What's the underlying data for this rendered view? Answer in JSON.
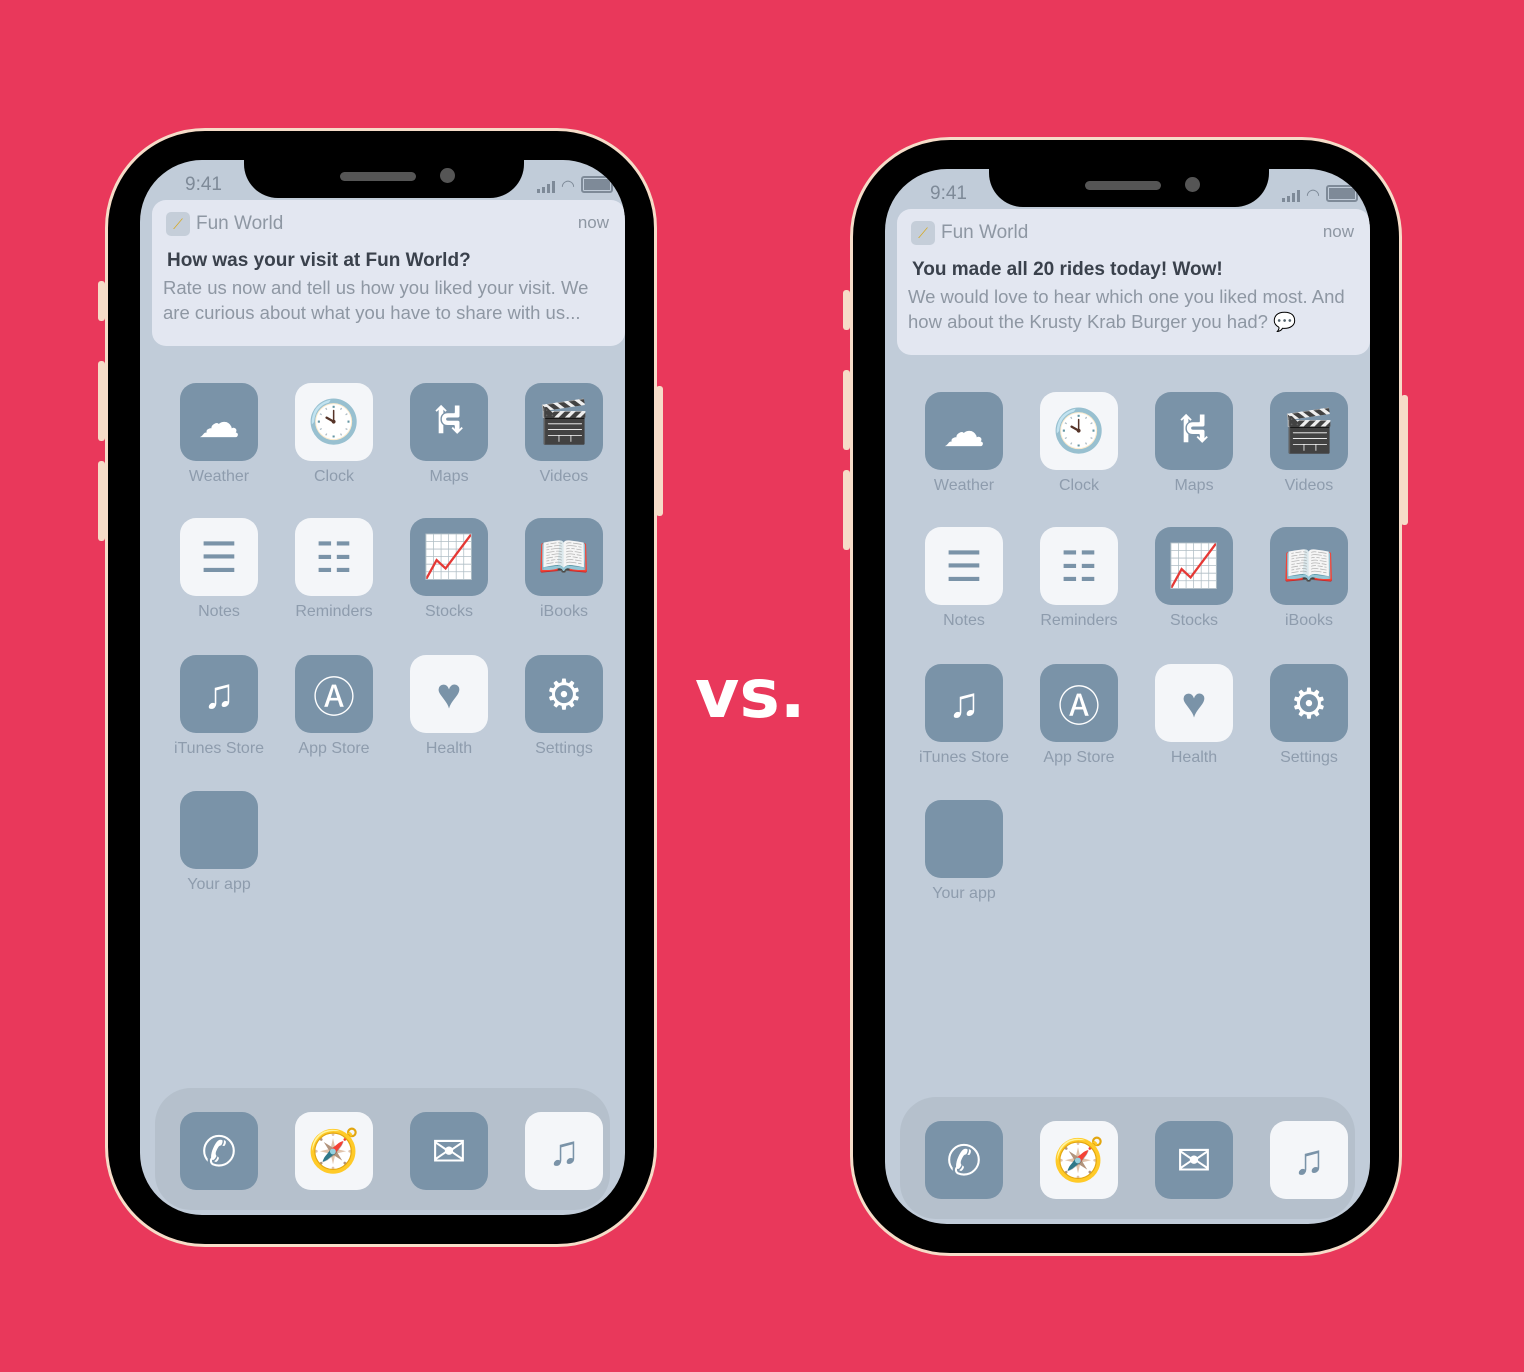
{
  "vs_label": "vs.",
  "status": {
    "time": "9:41"
  },
  "phones": [
    {
      "notification": {
        "app": "Fun World",
        "time": "now",
        "title": "How was your visit at Fun World?",
        "body": "Rate us now and tell us how you liked your visit. We are curious about what you have to share with us..."
      }
    },
    {
      "notification": {
        "app": "Fun World",
        "time": "now",
        "title": "You made all 20 rides today! Wow!",
        "body": "We would love to hear which one you liked most. And how about the Krusty Krab Burger you had? 💬"
      }
    }
  ],
  "apps": [
    {
      "label": "Weather",
      "icon": "weather-icon",
      "glyph": "☁"
    },
    {
      "label": "Clock",
      "icon": "clock-icon",
      "glyph": "🕙"
    },
    {
      "label": "Maps",
      "icon": "maps-icon",
      "glyph": "⛕"
    },
    {
      "label": "Videos",
      "icon": "videos-icon",
      "glyph": "🎬"
    },
    {
      "label": "Notes",
      "icon": "notes-icon",
      "glyph": "☰"
    },
    {
      "label": "Reminders",
      "icon": "reminders-icon",
      "glyph": "☷"
    },
    {
      "label": "Stocks",
      "icon": "stocks-icon",
      "glyph": "📈"
    },
    {
      "label": "iBooks",
      "icon": "ibooks-icon",
      "glyph": "📖"
    },
    {
      "label": "iTunes Store",
      "icon": "itunes-icon",
      "glyph": "♫"
    },
    {
      "label": "App Store",
      "icon": "appstore-icon",
      "glyph": "Ⓐ"
    },
    {
      "label": "Health",
      "icon": "health-icon",
      "glyph": "♥"
    },
    {
      "label": "Settings",
      "icon": "settings-icon",
      "glyph": "⚙"
    },
    {
      "label": "Your app",
      "icon": "your-app-icon",
      "glyph": ""
    }
  ],
  "dock": [
    {
      "icon": "phone-icon",
      "glyph": "✆"
    },
    {
      "icon": "safari-icon",
      "glyph": "🧭"
    },
    {
      "icon": "mail-icon",
      "glyph": "✉"
    },
    {
      "icon": "music-icon",
      "glyph": "♫"
    }
  ]
}
